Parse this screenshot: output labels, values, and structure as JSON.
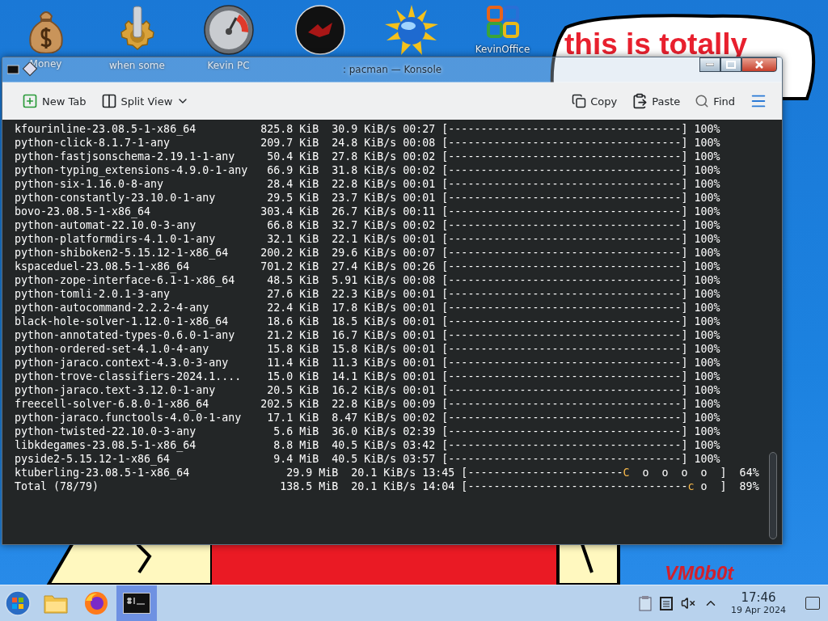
{
  "desktop": {
    "icons": [
      {
        "kind": "money",
        "label": "Money"
      },
      {
        "kind": "gear",
        "label": "when some"
      },
      {
        "kind": "gauge",
        "label": "Kevin PC"
      },
      {
        "kind": "disc"
      },
      {
        "kind": "sun"
      },
      {
        "kind": "office",
        "label": "KevinOffice"
      }
    ],
    "note": {
      "lines": [
        "this is totally"
      ]
    },
    "signature": "VM0b0t"
  },
  "window": {
    "title": ": pacman — Konsole",
    "toolbar": {
      "left": [
        {
          "kind": "new-tab",
          "label": "New Tab"
        },
        {
          "kind": "split",
          "label": "Split View"
        }
      ],
      "right": [
        {
          "kind": "copy",
          "label": "Copy"
        },
        {
          "kind": "paste",
          "label": "Paste"
        },
        {
          "kind": "find",
          "label": "Find"
        }
      ]
    },
    "terminal": {
      "lines": [
        {
          "kind": "done",
          "name": "kfourinline-23.08.5-1-x86_64",
          "size": "825.8 KiB",
          "rate": "30.9 KiB/s",
          "eta": "00:27",
          "bar": "[------------------------------------]",
          "percent": "100%"
        },
        {
          "kind": "done",
          "name": "python-click-8.1.7-1-any",
          "size": "209.7 KiB",
          "rate": "24.8 KiB/s",
          "eta": "00:08",
          "bar": "[------------------------------------]",
          "percent": "100%"
        },
        {
          "kind": "done",
          "name": "python-fastjsonschema-2.19.1-1-any",
          "size": "50.4 KiB",
          "rate": "27.8 KiB/s",
          "eta": "00:02",
          "bar": "[------------------------------------]",
          "percent": "100%"
        },
        {
          "kind": "done",
          "name": "python-typing_extensions-4.9.0-1-any",
          "size": "66.9 KiB",
          "rate": "31.8 KiB/s",
          "eta": "00:02",
          "bar": "[------------------------------------]",
          "percent": "100%"
        },
        {
          "kind": "done",
          "name": "python-six-1.16.0-8-any",
          "size": "28.4 KiB",
          "rate": "22.8 KiB/s",
          "eta": "00:01",
          "bar": "[------------------------------------]",
          "percent": "100%"
        },
        {
          "kind": "done",
          "name": "python-constantly-23.10.0-1-any",
          "size": "29.5 KiB",
          "rate": "23.7 KiB/s",
          "eta": "00:01",
          "bar": "[------------------------------------]",
          "percent": "100%"
        },
        {
          "kind": "done",
          "name": "bovo-23.08.5-1-x86_64",
          "size": "303.4 KiB",
          "rate": "26.7 KiB/s",
          "eta": "00:11",
          "bar": "[------------------------------------]",
          "percent": "100%"
        },
        {
          "kind": "done",
          "name": "python-automat-22.10.0-3-any",
          "size": "66.8 KiB",
          "rate": "32.7 KiB/s",
          "eta": "00:02",
          "bar": "[------------------------------------]",
          "percent": "100%"
        },
        {
          "kind": "done",
          "name": "python-platformdirs-4.1.0-1-any",
          "size": "32.1 KiB",
          "rate": "22.1 KiB/s",
          "eta": "00:01",
          "bar": "[------------------------------------]",
          "percent": "100%"
        },
        {
          "kind": "done",
          "name": "python-shiboken2-5.15.12-1-x86_64",
          "size": "200.2 KiB",
          "rate": "29.6 KiB/s",
          "eta": "00:07",
          "bar": "[------------------------------------]",
          "percent": "100%"
        },
        {
          "kind": "done",
          "name": "kspaceduel-23.08.5-1-x86_64",
          "size": "701.2 KiB",
          "rate": "27.4 KiB/s",
          "eta": "00:26",
          "bar": "[------------------------------------]",
          "percent": "100%"
        },
        {
          "kind": "done",
          "name": "python-zope-interface-6.1-1-x86_64",
          "size": "48.5 KiB",
          "rate": "5.91 KiB/s",
          "eta": "00:08",
          "bar": "[------------------------------------]",
          "percent": "100%"
        },
        {
          "kind": "done",
          "name": "python-tomli-2.0.1-3-any",
          "size": "27.6 KiB",
          "rate": "22.3 KiB/s",
          "eta": "00:01",
          "bar": "[------------------------------------]",
          "percent": "100%"
        },
        {
          "kind": "done",
          "name": "python-autocommand-2.2.2-4-any",
          "size": "22.4 KiB",
          "rate": "17.8 KiB/s",
          "eta": "00:01",
          "bar": "[------------------------------------]",
          "percent": "100%"
        },
        {
          "kind": "done",
          "name": "black-hole-solver-1.12.0-1-x86_64",
          "size": "18.6 KiB",
          "rate": "18.5 KiB/s",
          "eta": "00:01",
          "bar": "[------------------------------------]",
          "percent": "100%"
        },
        {
          "kind": "done",
          "name": "python-annotated-types-0.6.0-1-any",
          "size": "21.2 KiB",
          "rate": "16.7 KiB/s",
          "eta": "00:01",
          "bar": "[------------------------------------]",
          "percent": "100%"
        },
        {
          "kind": "done",
          "name": "python-ordered-set-4.1.0-4-any",
          "size": "15.8 KiB",
          "rate": "15.8 KiB/s",
          "eta": "00:01",
          "bar": "[------------------------------------]",
          "percent": "100%"
        },
        {
          "kind": "done",
          "name": "python-jaraco.context-4.3.0-3-any",
          "size": "11.4 KiB",
          "rate": "11.3 KiB/s",
          "eta": "00:01",
          "bar": "[------------------------------------]",
          "percent": "100%"
        },
        {
          "kind": "done",
          "name": "python-trove-classifiers-2024.1....",
          "size": "15.0 KiB",
          "rate": "14.1 KiB/s",
          "eta": "00:01",
          "bar": "[------------------------------------]",
          "percent": "100%"
        },
        {
          "kind": "done",
          "name": "python-jaraco.text-3.12.0-1-any",
          "size": "20.5 KiB",
          "rate": "16.2 KiB/s",
          "eta": "00:01",
          "bar": "[------------------------------------]",
          "percent": "100%"
        },
        {
          "kind": "done",
          "name": "freecell-solver-6.8.0-1-x86_64",
          "size": "202.5 KiB",
          "rate": "22.8 KiB/s",
          "eta": "00:09",
          "bar": "[------------------------------------]",
          "percent": "100%"
        },
        {
          "kind": "done",
          "name": "python-jaraco.functools-4.0.0-1-any",
          "size": "17.1 KiB",
          "rate": "8.47 KiB/s",
          "eta": "00:02",
          "bar": "[------------------------------------]",
          "percent": "100%"
        },
        {
          "kind": "done",
          "name": "python-twisted-22.10.0-3-any",
          "size": "5.6 MiB",
          "rate": "36.0 KiB/s",
          "eta": "02:39",
          "bar": "[------------------------------------]",
          "percent": "100%"
        },
        {
          "kind": "done",
          "name": "libkdegames-23.08.5-1-x86_64",
          "size": "8.8 MiB",
          "rate": "40.5 KiB/s",
          "eta": "03:42",
          "bar": "[------------------------------------]",
          "percent": "100%"
        },
        {
          "kind": "done",
          "name": "pyside2-5.15.12-1-x86_64",
          "size": "9.4 MiB",
          "rate": "40.5 KiB/s",
          "eta": "03:57",
          "bar": "[------------------------------------]",
          "percent": "100%"
        },
        {
          "kind": "progress",
          "name": "ktuberling-23.08.5-1-x86_64",
          "size": "29.9 MiB",
          "rate": "20.1 KiB/s",
          "eta": "13:45",
          "bar_done": "[------------------------",
          "pacman": "C",
          "bar_rest": "  o  o  o  o  ]",
          "percent": "64%"
        },
        {
          "kind": "progress",
          "name": "Total (78/79)",
          "size": "138.5 MiB",
          "rate": "20.1 KiB/s",
          "eta": "14:04",
          "bar_done": "[----------------------------------",
          "pacman": "c",
          "bar_rest": " o  ]",
          "percent": "89%"
        }
      ]
    }
  },
  "taskbar": {
    "apps": [
      {
        "kind": "files",
        "selected": false
      },
      {
        "kind": "firefox",
        "selected": false
      },
      {
        "kind": "konsole",
        "selected": true
      }
    ],
    "clock": {
      "time": "17:46",
      "date": "19 Apr 2024"
    }
  }
}
